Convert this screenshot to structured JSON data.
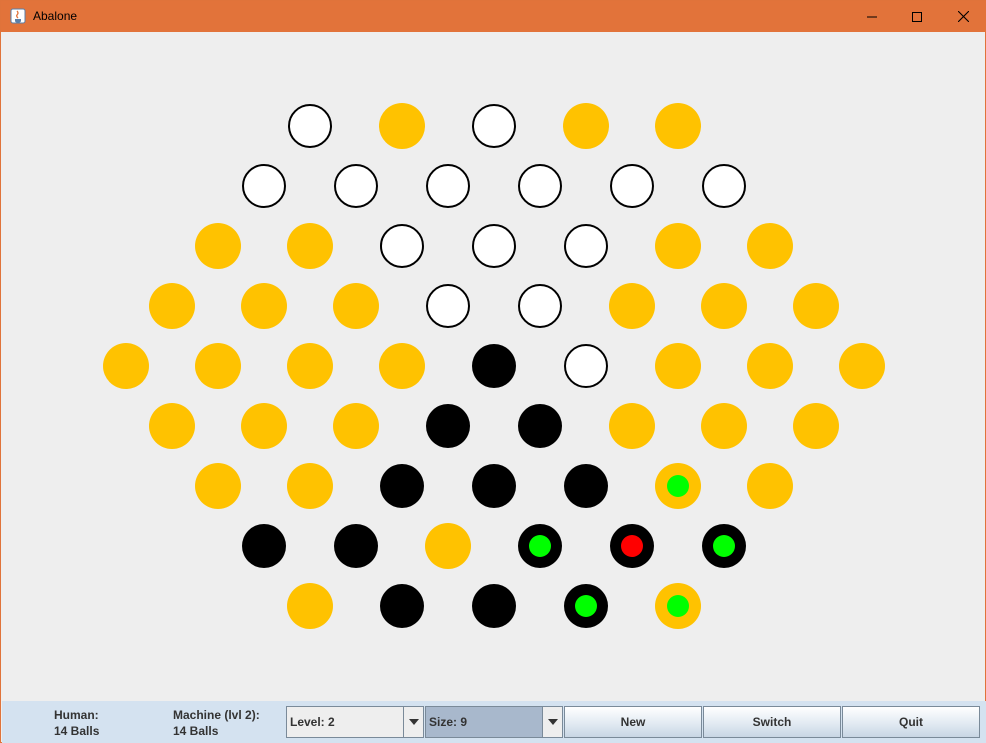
{
  "window": {
    "title": "Abalone",
    "controls": {
      "minimize": "—",
      "maximize": "☐",
      "close": "✕"
    }
  },
  "board": {
    "colors": {
      "empty": "#ffc200",
      "white": "#ffffff",
      "black": "#000000",
      "selected_marker": "#00ff00",
      "target_marker": "#ff0000"
    },
    "rows": [
      [
        "W",
        "E",
        "W",
        "E",
        "E"
      ],
      [
        "W",
        "W",
        "W",
        "W",
        "W",
        "W"
      ],
      [
        "E",
        "E",
        "W",
        "W",
        "W",
        "E",
        "E"
      ],
      [
        "E",
        "E",
        "E",
        "W",
        "W",
        "E",
        "E",
        "E"
      ],
      [
        "E",
        "E",
        "E",
        "E",
        "B",
        "W",
        "E",
        "E",
        "E"
      ],
      [
        "E",
        "E",
        "E",
        "B",
        "B",
        "E",
        "E",
        "E"
      ],
      [
        "E",
        "E",
        "B",
        "B",
        "B",
        "E:g",
        "E"
      ],
      [
        "B",
        "B",
        "E",
        "B:g",
        "B:r",
        "B:g"
      ],
      [
        "E",
        "B",
        "B",
        "B:g",
        "E:g"
      ]
    ]
  },
  "status": {
    "human_label": "Human:",
    "human_balls": "14 Balls",
    "machine_label": "Machine (lvl 2):",
    "machine_balls": "14 Balls"
  },
  "controls": {
    "level_value": "Level: 2",
    "size_value": "Size: 9",
    "new_label": "New",
    "switch_label": "Switch",
    "quit_label": "Quit"
  }
}
